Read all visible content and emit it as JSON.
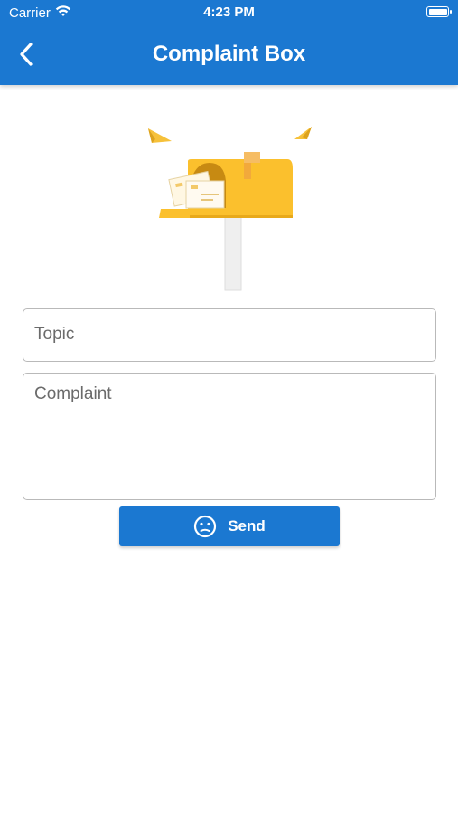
{
  "status_bar": {
    "carrier": "Carrier",
    "time": "4:23 PM",
    "battery_level": 1.0
  },
  "header": {
    "title": "Complaint Box",
    "back_icon": "chevron-left-icon",
    "background_color": "#1b78d1"
  },
  "illustration": {
    "icon": "mailbox-icon"
  },
  "form": {
    "topic_placeholder": "Topic",
    "complaint_placeholder": "Complaint"
  },
  "send_button": {
    "label": "Send",
    "icon": "neutral-face-icon",
    "color": "#1b78d1"
  }
}
